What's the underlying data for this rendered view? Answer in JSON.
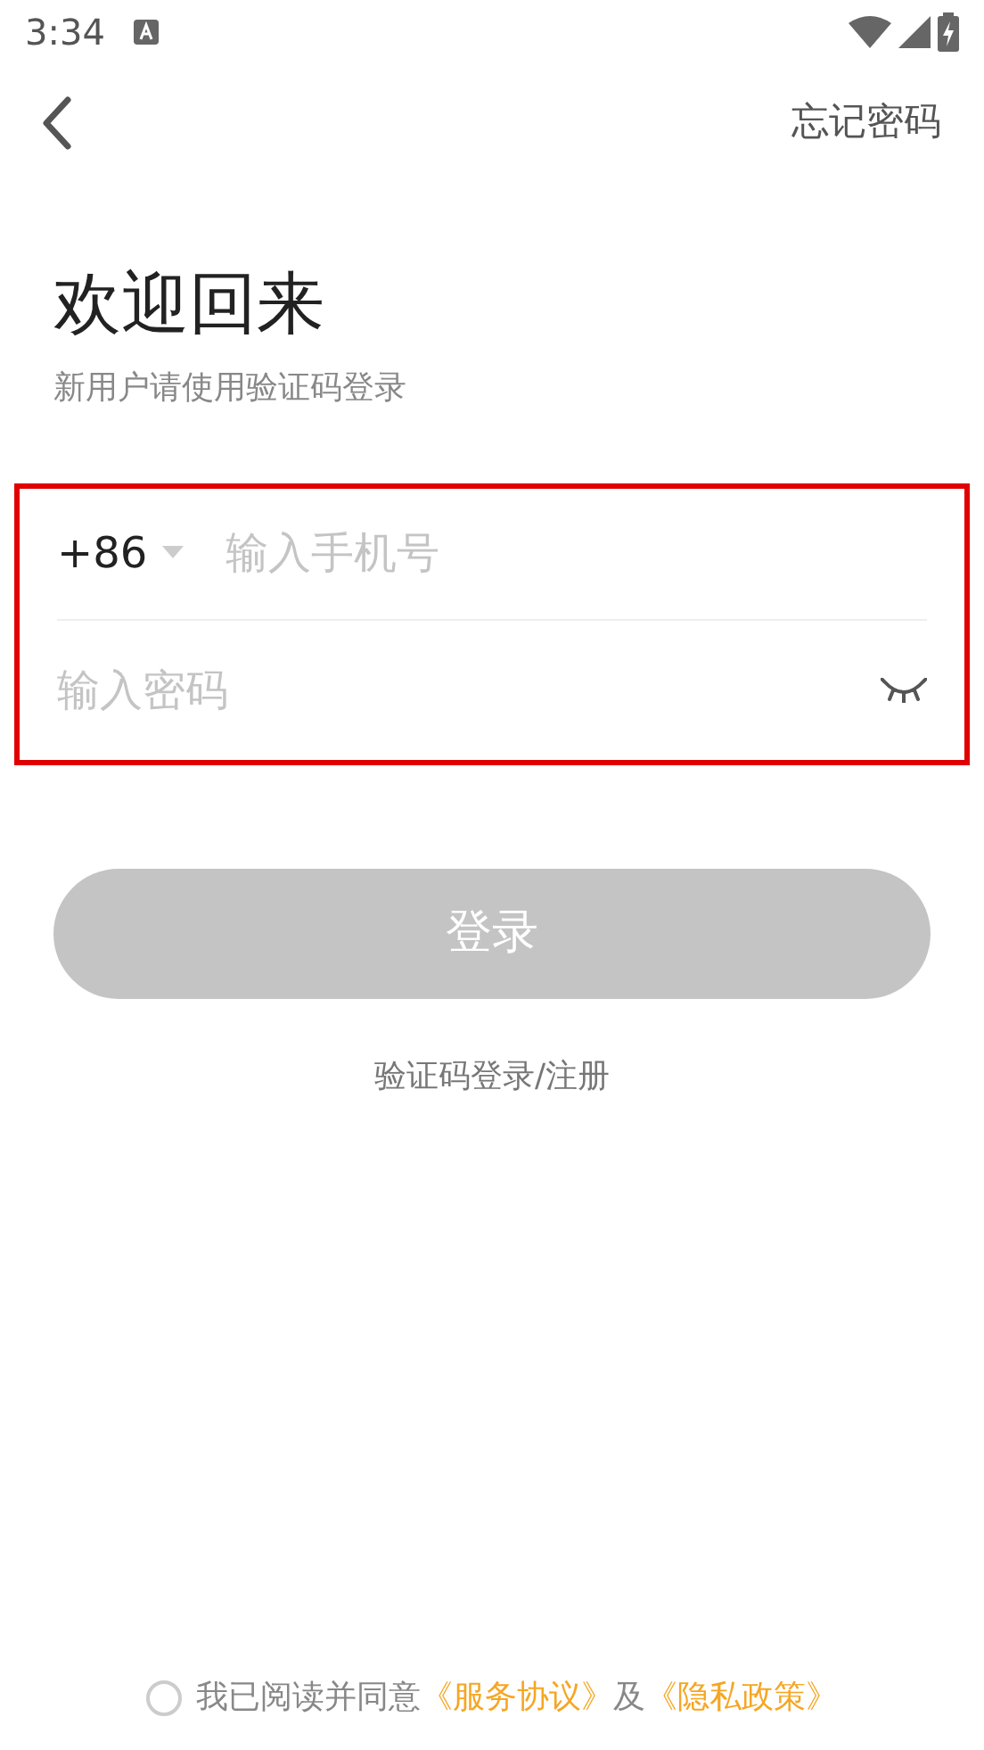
{
  "status_bar": {
    "time": "3:34"
  },
  "header": {
    "action": "忘记密码"
  },
  "title": "欢迎回来",
  "subtitle": "新用户请使用验证码登录",
  "form": {
    "country_code": "+86",
    "phone": {
      "placeholder": "输入手机号"
    },
    "password": {
      "placeholder": "输入密码"
    },
    "highlighted": true
  },
  "login_button": {
    "label": "登录",
    "disabled": true
  },
  "alt_login": "验证码登录/注册",
  "agreement": {
    "checked": false,
    "text": "我已阅读并同意",
    "link_1": "《服务协议》",
    "joiner": "及",
    "link_2": "《隐私政策》"
  }
}
